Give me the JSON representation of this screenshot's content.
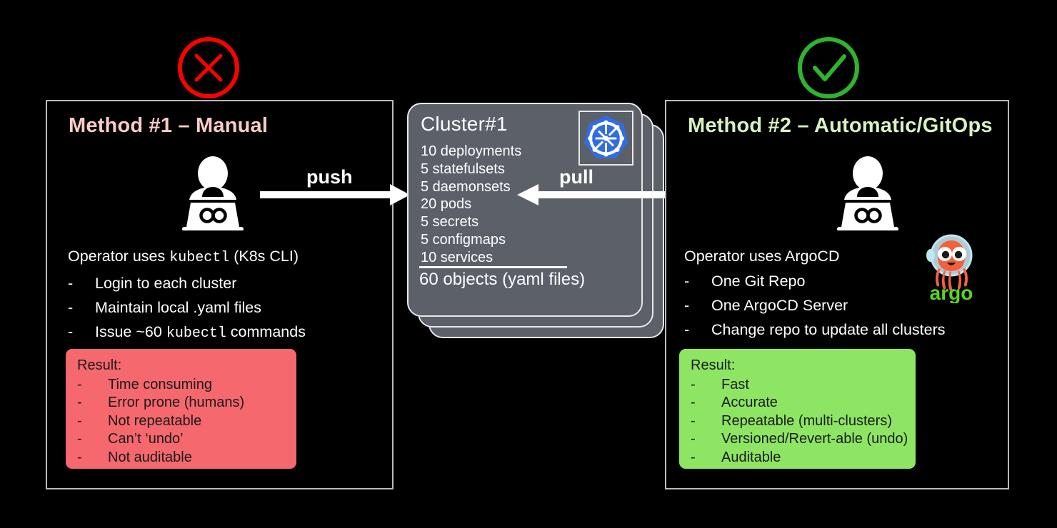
{
  "left_panel": {
    "title": "Method #1 – Manual",
    "title_color": "#f9ccc9",
    "verdict_icon": "cross-circle-icon",
    "verdict_color": "#ff0000",
    "operator_icon": "operator-at-laptop-icon",
    "description": {
      "lead_prefix": "Operator uses ",
      "lead_mono": "kubectl",
      "lead_suffix": " (K8s CLI)",
      "bullets": [
        {
          "text": "Login to each cluster"
        },
        {
          "text": "Maintain local .yaml files"
        },
        {
          "prefix": "Issue ~60 ",
          "mono": "kubectl",
          "suffix": " commands"
        }
      ],
      "bullet_marker": "-"
    },
    "result": {
      "heading": "Result:",
      "bg_color": "#f4686e",
      "items": [
        "Time consuming",
        "Error prone (humans)",
        "Not repeatable",
        "Can’t ‘undo’",
        "Not auditable"
      ]
    }
  },
  "right_panel": {
    "title": "Method #2 – Automatic/GitOps",
    "title_color": "#d9f2c0",
    "verdict_icon": "check-circle-icon",
    "verdict_color": "#2db52d",
    "operator_icon": "operator-at-laptop-icon",
    "git_repo_label": "Git Repo",
    "argo_logo_text": "argo",
    "description": {
      "lead_prefix": "Operator uses ArgoCD",
      "bullets": [
        {
          "text": "One Git Repo"
        },
        {
          "text": "One ArgoCD Server"
        },
        {
          "text": "Change repo to update all clusters"
        }
      ],
      "bullet_marker": "-"
    },
    "result": {
      "heading": "Result:",
      "bg_color": "#8ee563",
      "items": [
        "Fast",
        "Accurate",
        "Repeatable (multi-clusters)",
        "Versioned/Revert-able (undo)",
        "Auditable"
      ]
    }
  },
  "cluster": {
    "name": "Cluster#1",
    "logo_icon": "kubernetes-helm-wheel-icon",
    "logo_color": "#326ce5",
    "card_color": "#5b6069",
    "objects": [
      "10 deployments",
      "5 statefulsets",
      "5 daemonsets",
      "20 pods",
      "5 secrets",
      "5 configmaps",
      "10 services"
    ],
    "total": "60 objects (yaml files)",
    "stack_count": 3
  },
  "arrows": {
    "push_label": "push",
    "pull_label": "pull",
    "push_direction": "right",
    "pull_direction": "left",
    "gitrepo_direction": "left"
  }
}
